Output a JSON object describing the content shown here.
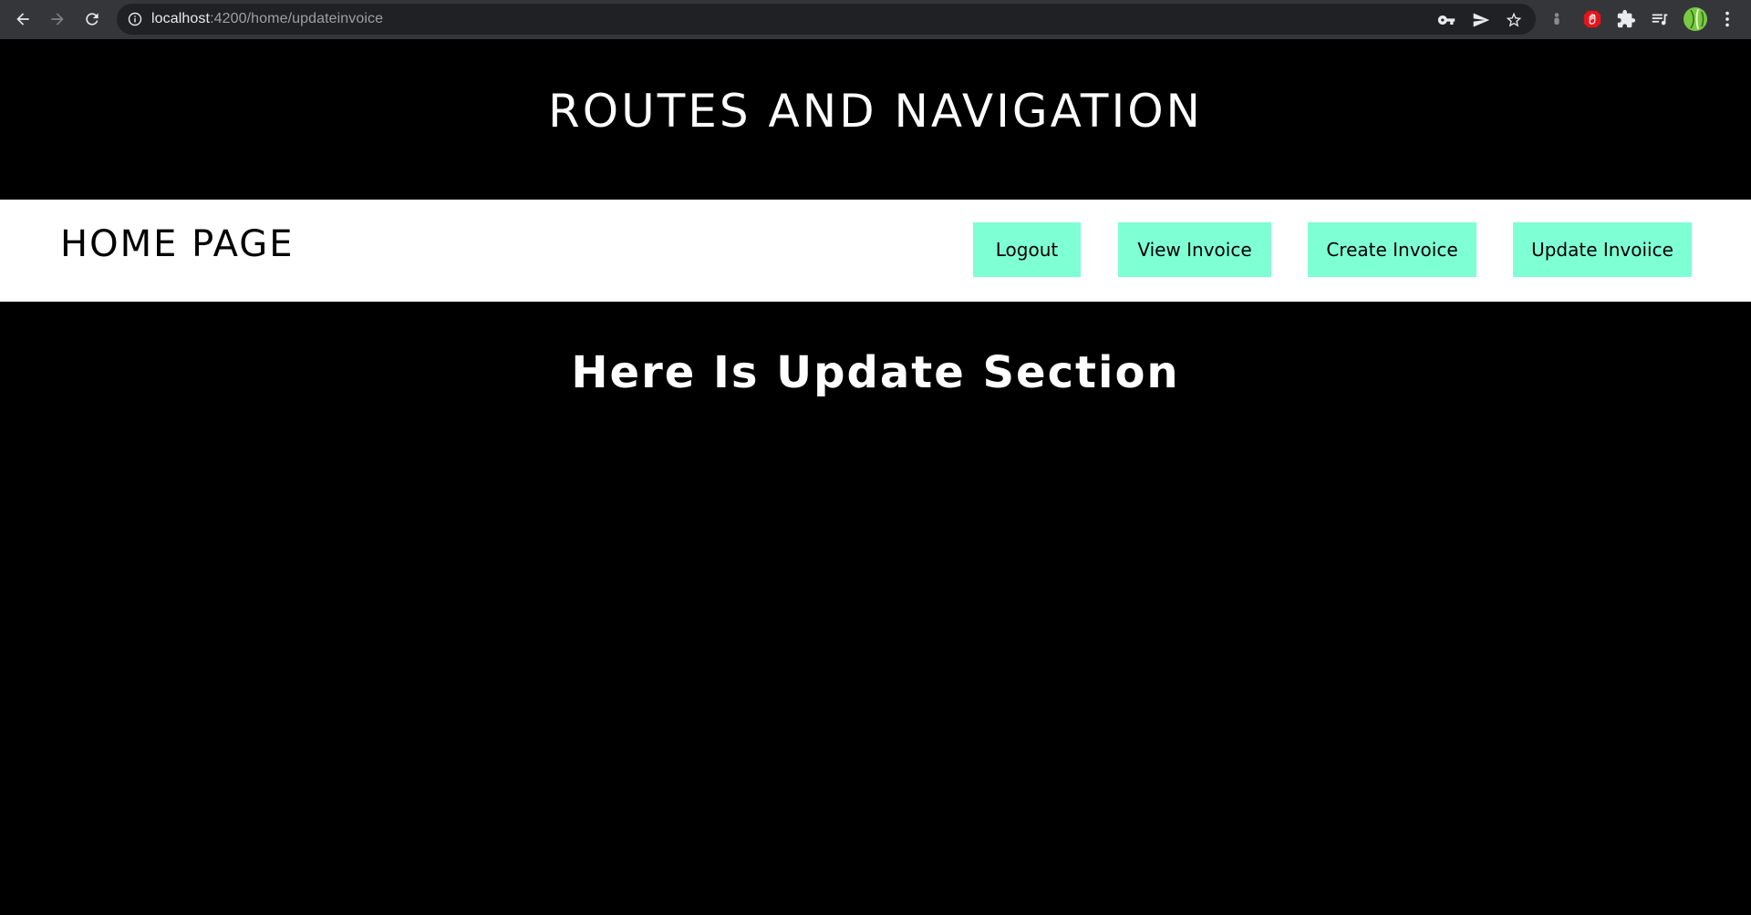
{
  "browser": {
    "url_host": "localhost",
    "url_rest": ":4200/home/updateinvoice"
  },
  "header": {
    "title": "ROUTES AND NAVIGATION"
  },
  "navbar": {
    "brand": "HOME PAGE",
    "buttons": [
      {
        "label": "Logout"
      },
      {
        "label": "View Invoice"
      },
      {
        "label": "Create Invoice"
      },
      {
        "label": "Update Invoiice"
      }
    ]
  },
  "main": {
    "heading": "Here Is Update Section"
  },
  "colors": {
    "page_background": "#000000",
    "navbar_background": "#ffffff",
    "button_background": "#7fffd4",
    "browser_toolbar": "#35363a",
    "omnibox": "#202124"
  }
}
